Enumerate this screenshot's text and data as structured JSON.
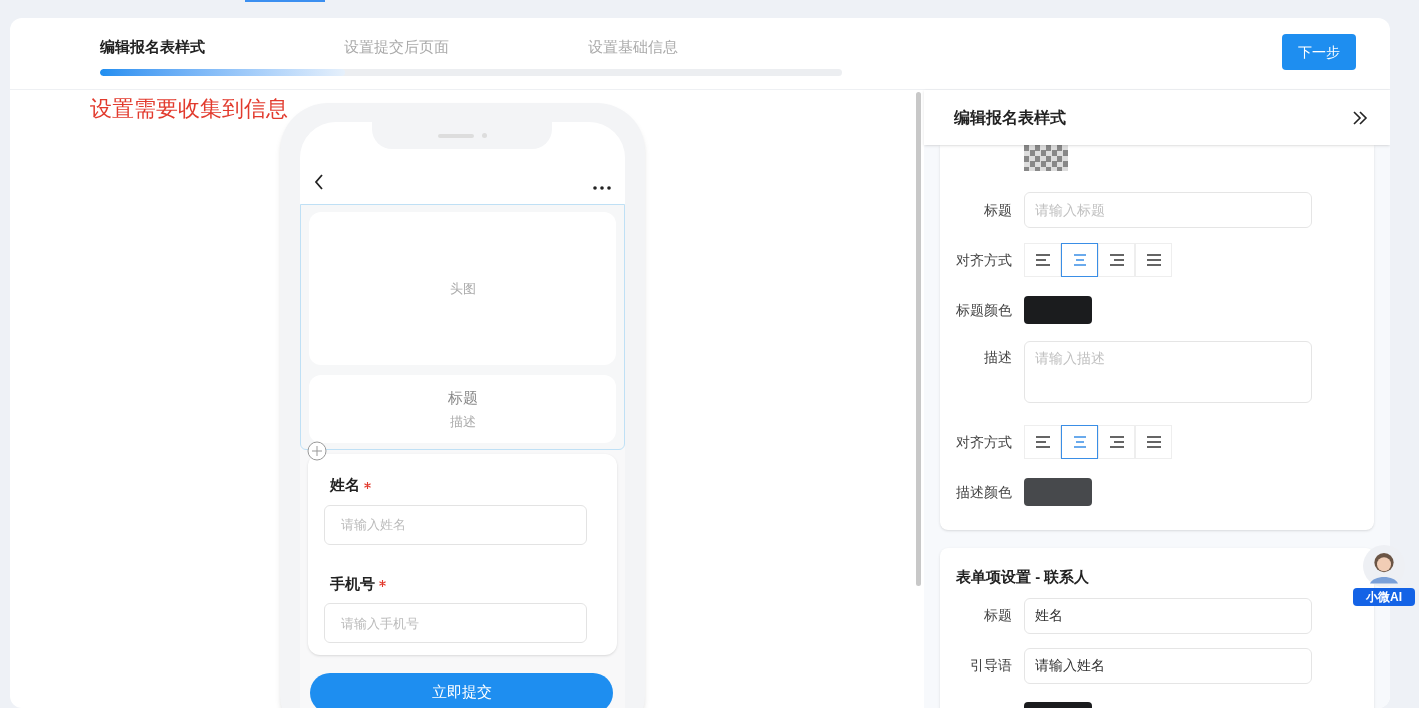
{
  "steps": [
    {
      "label": "编辑报名表样式",
      "selected": true
    },
    {
      "label": "设置提交后页面",
      "selected": false
    },
    {
      "label": "设置基础信息",
      "selected": false
    }
  ],
  "progress": {
    "level": 0.33
  },
  "next_button": "下一步",
  "hint": "设置需要收集到信息",
  "phone": {
    "header_image": "头图",
    "title": "标题",
    "description": "描述",
    "fields": [
      {
        "label": "姓名",
        "required": true,
        "placeholder": "请输入姓名"
      },
      {
        "label": "手机号",
        "required": true,
        "placeholder": "请输入手机号"
      }
    ],
    "submit": "立即提交"
  },
  "panel": {
    "title": "编辑报名表样式",
    "style_rows": [
      {
        "kind": "image"
      },
      {
        "kind": "input",
        "label": "标题",
        "placeholder": "请输入标题"
      },
      {
        "kind": "align",
        "label": "对齐方式",
        "options": [
          {
            "kind": "left",
            "selected": false
          },
          {
            "kind": "center",
            "selected": true
          },
          {
            "kind": "right",
            "selected": false
          },
          {
            "kind": "justify",
            "selected": false
          }
        ]
      },
      {
        "kind": "color",
        "label": "标题颜色",
        "color": "#1b1c1e"
      },
      {
        "kind": "textarea",
        "label": "描述",
        "placeholder": "请输入描述"
      },
      {
        "kind": "align",
        "label": "对齐方式",
        "options": [
          {
            "kind": "left",
            "selected": false
          },
          {
            "kind": "center",
            "selected": true
          },
          {
            "kind": "right",
            "selected": false
          },
          {
            "kind": "justify",
            "selected": false
          }
        ]
      },
      {
        "kind": "color",
        "label": "描述颜色",
        "color": "#47494c"
      }
    ],
    "item_title": "表单项设置 - 联系人",
    "item_rows": [
      {
        "kind": "input",
        "label": "标题",
        "value": "姓名"
      },
      {
        "kind": "input",
        "label": "引导语",
        "value": "请输入姓名"
      },
      {
        "kind": "color",
        "color": "#1b1c1e"
      }
    ]
  },
  "assistant": {
    "label": "小微AI"
  }
}
